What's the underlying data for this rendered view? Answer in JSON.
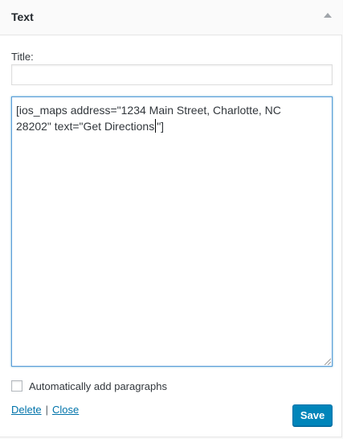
{
  "widget": {
    "title": "Text"
  },
  "form": {
    "title_label": "Title:",
    "title_value": "",
    "content_line1": "[ios_maps address=\"1234 Main Street, Charlotte, NC",
    "content_line2_before_caret": "28202\" text=\"Get Directions",
    "content_line2_after_caret": "\"]",
    "autop_label": "Automatically add paragraphs",
    "autop_checked": false
  },
  "controls": {
    "delete_label": "Delete",
    "separator": "|",
    "close_label": "Close",
    "save_label": "Save"
  },
  "colors": {
    "accent": "#0085ba",
    "link": "#0073aa",
    "focus_border": "#5b9dd9"
  },
  "icons": {
    "toggle": "triangle-up-icon",
    "resize": "resize-grip-icon"
  }
}
